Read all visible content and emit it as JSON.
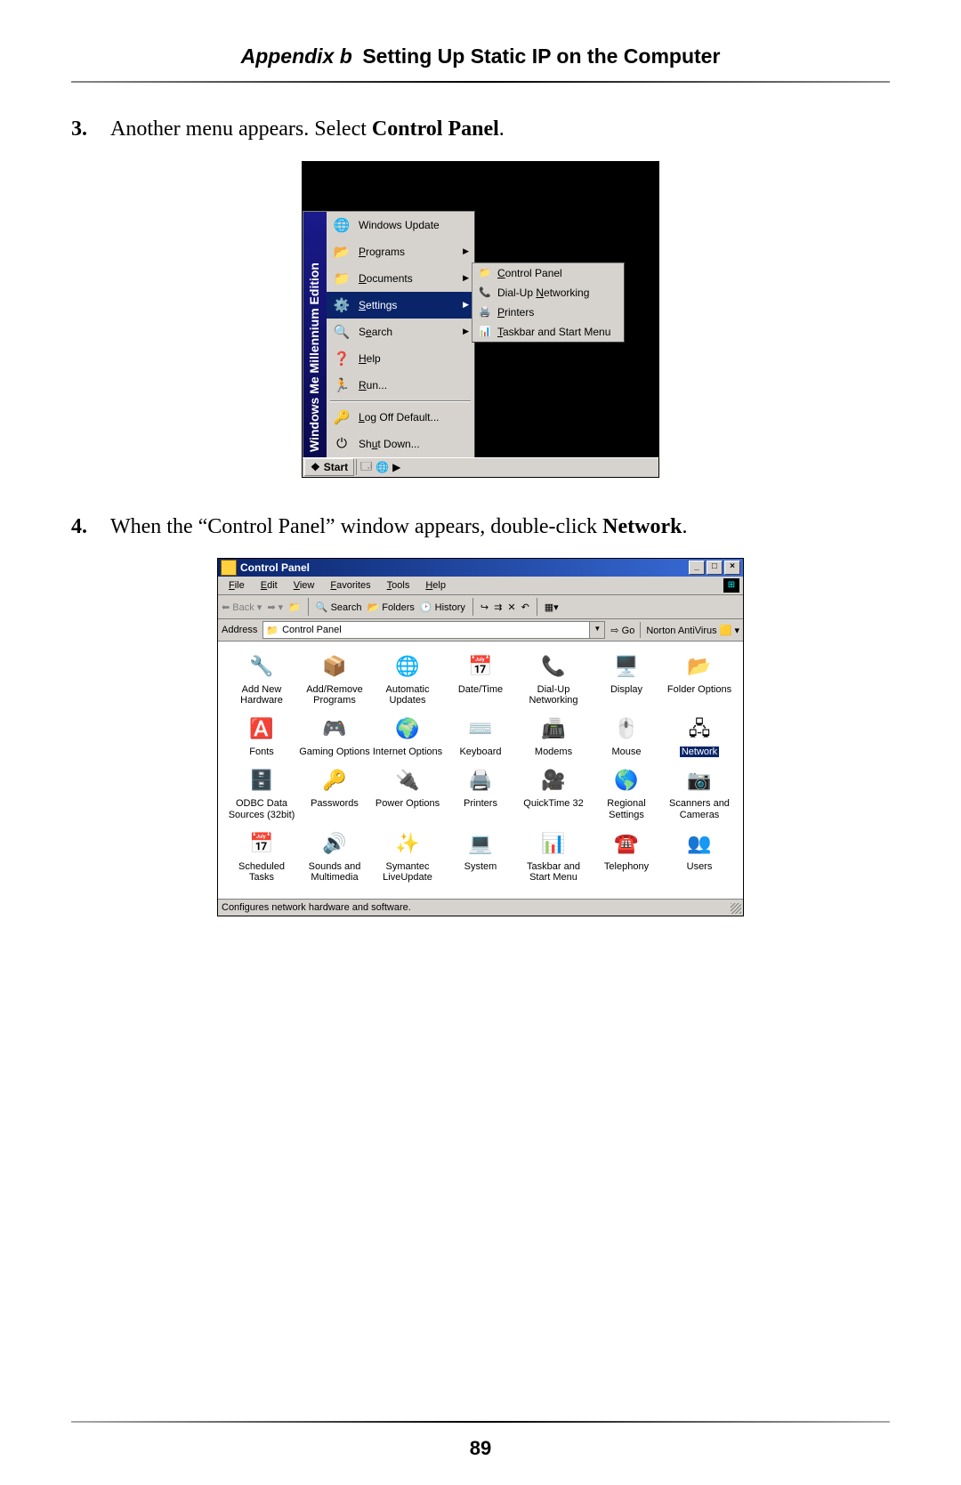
{
  "header": {
    "appendix": "Appendix b",
    "title": "Setting Up Static IP on the Computer"
  },
  "steps": {
    "s3": {
      "n": "3.",
      "pre": "Another menu appears. Select ",
      "bold": "Control Panel",
      "post": "."
    },
    "s4": {
      "n": "4.",
      "pre": "When the “Control Panel” window appears, double-click ",
      "bold": "Network",
      "post": "."
    }
  },
  "page_number": "89",
  "startmenu": {
    "brand": "Windows Me  Millennium Edition",
    "items": [
      {
        "icon": "🌐",
        "label": "Windows Update"
      },
      {
        "icon": "📂",
        "label": "Programs",
        "arrow": true,
        "u": 0
      },
      {
        "icon": "📁",
        "label": "Documents",
        "arrow": true,
        "u": 0
      },
      {
        "icon": "⚙️",
        "label": "Settings",
        "arrow": true,
        "sel": true,
        "u": 0
      },
      {
        "icon": "🔍",
        "label": "Search",
        "arrow": true,
        "u": 1
      },
      {
        "icon": "❓",
        "label": "Help",
        "u": 0
      },
      {
        "icon": "🏃",
        "label": "Run...",
        "u": 0
      },
      {
        "sep": true
      },
      {
        "icon": "🔑",
        "label": "Log Off Default...",
        "u": 0
      },
      {
        "icon": "⏻",
        "label": "Shut Down...",
        "u": 2
      }
    ],
    "submenu": [
      {
        "icon": "📁",
        "label": "Control Panel",
        "u": 0
      },
      {
        "icon": "📞",
        "label": "Dial-Up Networking",
        "u": 8
      },
      {
        "icon": "🖨️",
        "label": "Printers",
        "u": 0
      },
      {
        "icon": "📊",
        "label": "Taskbar and Start Menu",
        "u": 0
      }
    ],
    "start": "Start"
  },
  "cp": {
    "title": "Control Panel",
    "menus": [
      "File",
      "Edit",
      "View",
      "Favorites",
      "Tools",
      "Help"
    ],
    "toolbar": {
      "back": "Back",
      "search": "Search",
      "folders": "Folders",
      "history": "History"
    },
    "address_label": "Address",
    "address_value": "Control Panel",
    "go": "Go",
    "norton": "Norton AntiVirus",
    "icons": [
      {
        "e": "🔧",
        "l": "Add New Hardware"
      },
      {
        "e": "📦",
        "l": "Add/Remove Programs"
      },
      {
        "e": "🌐",
        "l": "Automatic Updates"
      },
      {
        "e": "📅",
        "l": "Date/Time"
      },
      {
        "e": "📞",
        "l": "Dial-Up Networking"
      },
      {
        "e": "🖥️",
        "l": "Display"
      },
      {
        "e": "📂",
        "l": "Folder Options"
      },
      {
        "e": "🅰️",
        "l": "Fonts"
      },
      {
        "e": "🎮",
        "l": "Gaming Options"
      },
      {
        "e": "🌍",
        "l": "Internet Options"
      },
      {
        "e": "⌨️",
        "l": "Keyboard"
      },
      {
        "e": "📠",
        "l": "Modems"
      },
      {
        "e": "🖱️",
        "l": "Mouse"
      },
      {
        "e": "🖧",
        "l": "Network",
        "sel": true
      },
      {
        "e": "🗄️",
        "l": "ODBC Data Sources (32bit)"
      },
      {
        "e": "🔑",
        "l": "Passwords"
      },
      {
        "e": "🔌",
        "l": "Power Options"
      },
      {
        "e": "🖨️",
        "l": "Printers"
      },
      {
        "e": "🎥",
        "l": "QuickTime 32"
      },
      {
        "e": "🌎",
        "l": "Regional Settings"
      },
      {
        "e": "📷",
        "l": "Scanners and Cameras"
      },
      {
        "e": "📅",
        "l": "Scheduled Tasks"
      },
      {
        "e": "🔊",
        "l": "Sounds and Multimedia"
      },
      {
        "e": "✨",
        "l": "Symantec LiveUpdate"
      },
      {
        "e": "💻",
        "l": "System"
      },
      {
        "e": "📊",
        "l": "Taskbar and Start Menu"
      },
      {
        "e": "☎️",
        "l": "Telephony"
      },
      {
        "e": "👥",
        "l": "Users"
      }
    ],
    "status": "Configures network hardware and software."
  }
}
